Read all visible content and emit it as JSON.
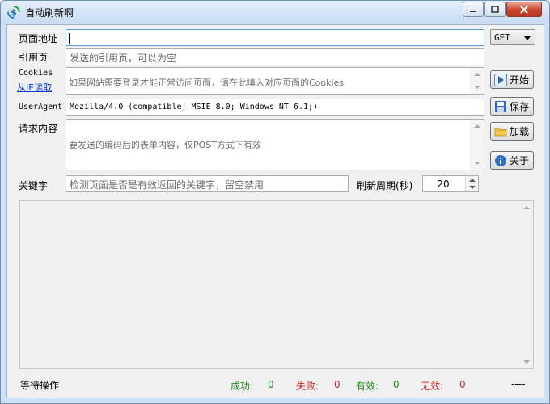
{
  "window": {
    "title": "自动刷新啊",
    "icon": "dollar-refresh-icon"
  },
  "controls": {
    "minimize_icon": "minimize-icon",
    "maximize_icon": "maximize-icon",
    "close_icon": "close-icon"
  },
  "form": {
    "url_label": "页面地址",
    "url_value": "",
    "method": "GET",
    "referer_label": "引用页",
    "referer_hint": "发送的引用页，可以为空",
    "cookies_label": "Cookies",
    "cookies_link": "从IE读取",
    "cookies_hint": "如果网站需要登录才能正常访问页面，请在此填入对应页面的Cookies",
    "useragent_label": "UserAgent",
    "useragent_value": "Mozilla/4.0 (compatible; MSIE 8.0; Windows NT 6.1;)",
    "post_label": "请求内容",
    "post_hint": "要发送的编码后的表单内容，仅POST方式下有效",
    "keyword_label": "关键字",
    "keyword_hint": "检测页面是否是有效返回的关键字，留空禁用",
    "interval_label": "刷新周期(秒)",
    "interval_value": "20"
  },
  "buttons": {
    "start": "开始",
    "save": "保存",
    "load": "加载",
    "about": "关于"
  },
  "status": {
    "state": "等待操作",
    "success_label": "成功:",
    "success_count": "0",
    "fail_label": "失败:",
    "fail_count": "0",
    "valid_label": "有效:",
    "valid_count": "0",
    "invalid_label": "无效:",
    "invalid_count": "0",
    "extra": "----"
  }
}
